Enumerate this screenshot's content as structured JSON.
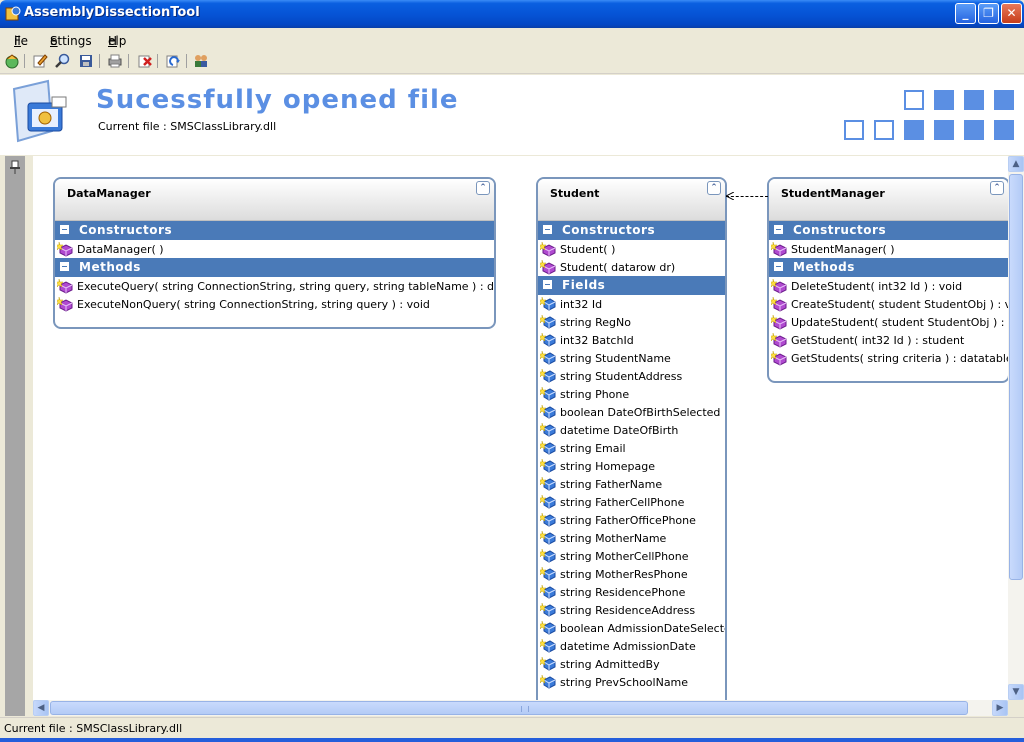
{
  "window": {
    "title": "AssemblyDissectionTool"
  },
  "menu": {
    "file": {
      "label": "File",
      "accel": "F",
      "rest": "ile"
    },
    "settings": {
      "label": "Settings",
      "accel": "S",
      "rest": "ettings"
    },
    "help": {
      "label": "Help",
      "accel": "H",
      "rest": "elp"
    }
  },
  "toolbar": {
    "icons": [
      "open-globe-icon",
      "edit-icon",
      "search-icon",
      "save-icon",
      "print-icon",
      "clear-icon",
      "refresh-icon",
      "users-icon"
    ]
  },
  "header": {
    "heading": "Sucessfully opened file",
    "current_file": "Current file : SMSClassLibrary.dll"
  },
  "colors": {
    "accent": "#5b8fe3",
    "section": "#4a7ab8",
    "border": "#7a96bc"
  },
  "classes": {
    "datamanager": {
      "name": "DataManager",
      "constructors_label": "Constructors",
      "constructors": [
        "DataManager( )"
      ],
      "methods_label": "Methods",
      "methods": [
        "ExecuteQuery( string ConnectionString, string query, string tableName ) : datatable",
        "ExecuteNonQuery( string ConnectionString, string query ) : void"
      ]
    },
    "student": {
      "name": "Student",
      "constructors_label": "Constructors",
      "constructors": [
        "Student( )",
        "Student( datarow dr)"
      ],
      "fields_label": "Fields",
      "fields": [
        "int32 Id",
        "string RegNo",
        "int32 BatchId",
        "string StudentName",
        "string StudentAddress",
        "string Phone",
        "boolean DateOfBirthSelected",
        "datetime DateOfBirth",
        "string Email",
        "string Homepage",
        "string FatherName",
        "string FatherCellPhone",
        "string FatherOfficePhone",
        "string MotherName",
        "string MotherCellPhone",
        "string MotherResPhone",
        "string ResidencePhone",
        "string ResidenceAddress",
        "boolean AdmissionDateSelected",
        "datetime AdmissionDate",
        "string AdmittedBy",
        "string PrevSchoolName"
      ]
    },
    "studentmanager": {
      "name": "StudentManager",
      "constructors_label": "Constructors",
      "constructors": [
        "StudentManager( )"
      ],
      "methods_label": "Methods",
      "methods": [
        "DeleteStudent( int32 Id ) : void",
        "CreateStudent( student StudentObj ) : void",
        "UpdateStudent( student StudentObj ) : void",
        "GetStudent( int32 Id ) : student",
        "GetStudents( string criteria ) : datatable"
      ]
    }
  },
  "status": {
    "text": "Current file : SMSClassLibrary.dll"
  }
}
